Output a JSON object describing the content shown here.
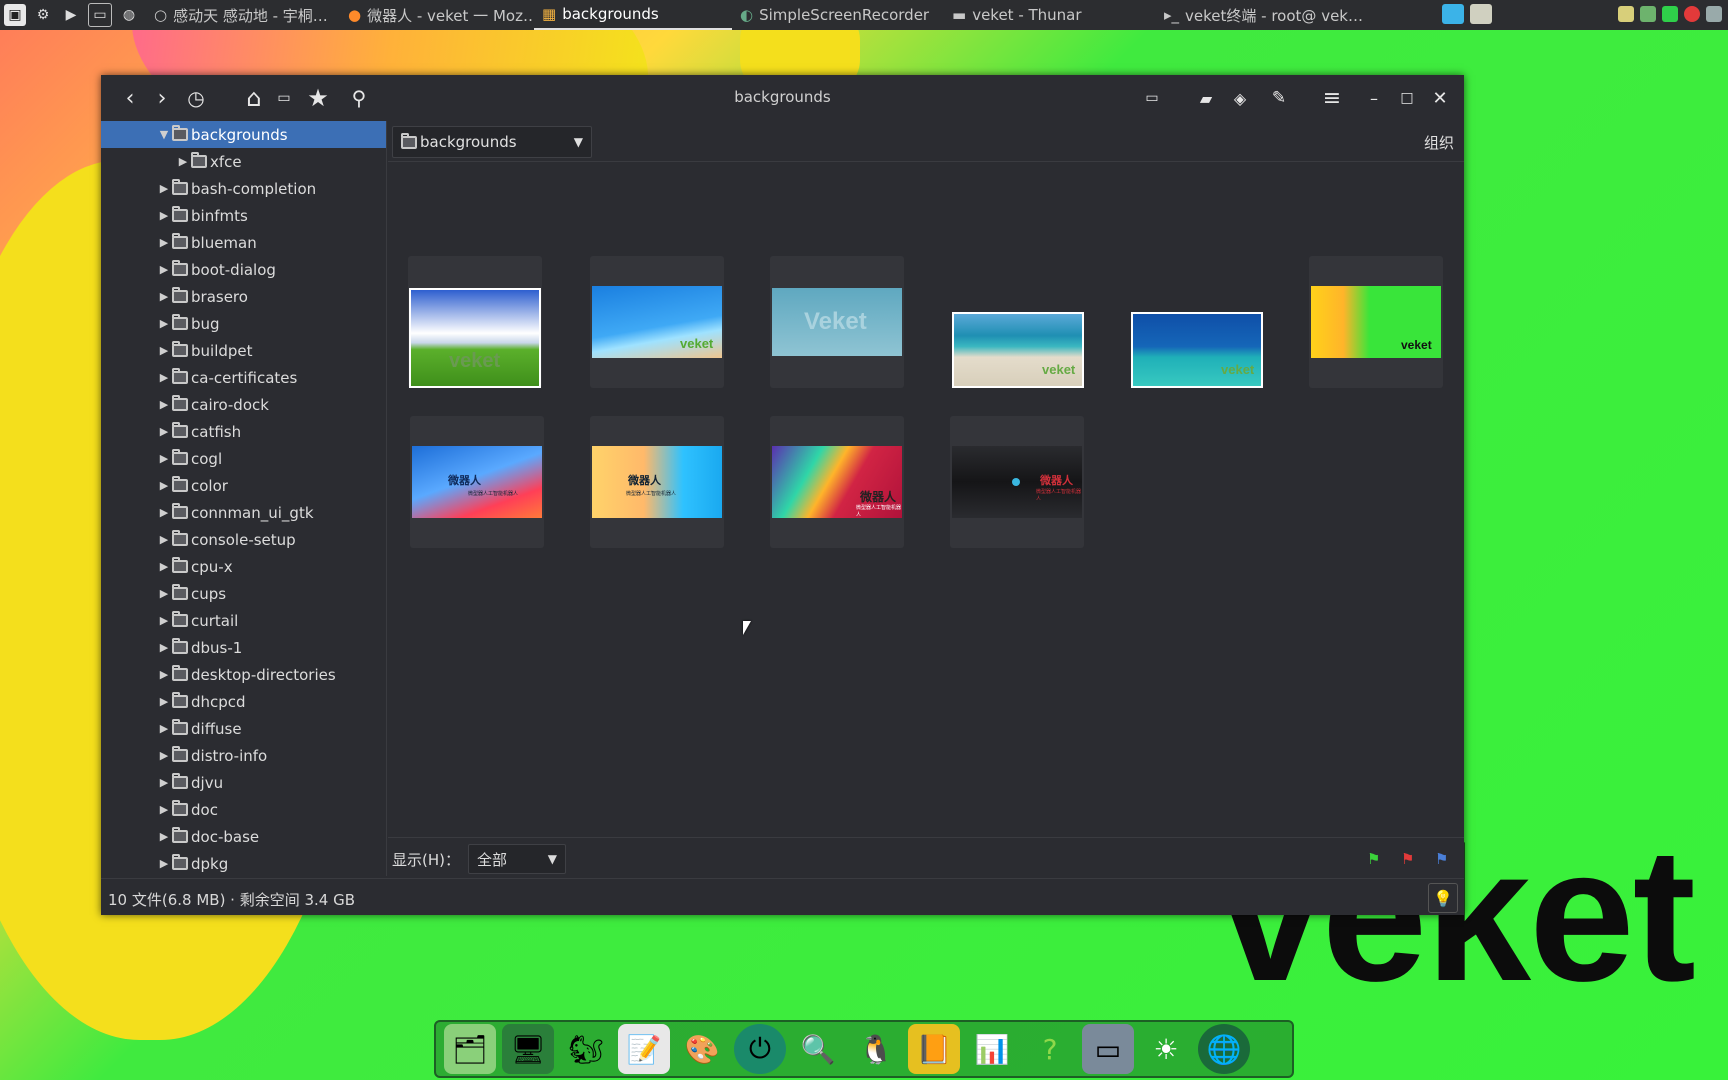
{
  "taskbar": {
    "tasks": [
      {
        "label": "感动天 感动地 - 宇桐…",
        "icon": "music-icon"
      },
      {
        "label": "微器人 - veket 一 Moz…",
        "icon": "firefox-icon"
      },
      {
        "label": "backgrounds",
        "icon": "image-viewer-icon",
        "active": true
      },
      {
        "label": "SimpleScreenRecorder",
        "icon": "recorder-icon"
      },
      {
        "label": "veket - Thunar",
        "icon": "folder-icon"
      },
      {
        "label": "veket终端 - root@ vek…",
        "icon": "terminal-icon"
      }
    ]
  },
  "window": {
    "title": "backgrounds",
    "toolbar": {
      "back": "‹",
      "forward": "›"
    }
  },
  "sidebar": {
    "selected": "backgrounds",
    "child": "xfce",
    "items": [
      "bash-completion",
      "binfmts",
      "blueman",
      "boot-dialog",
      "brasero",
      "bug",
      "buildpet",
      "ca-certificates",
      "cairo-dock",
      "catfish",
      "cogl",
      "color",
      "connman_ui_gtk",
      "console-setup",
      "cpu-x",
      "cups",
      "curtail",
      "dbus-1",
      "desktop-directories",
      "dhcpcd",
      "diffuse",
      "distro-info",
      "djvu",
      "doc",
      "doc-base",
      "dpkg"
    ]
  },
  "pathbar": {
    "current": "backgrounds",
    "organize": "组织"
  },
  "thumbnails": [
    {
      "label": "veket",
      "colors": [
        "#3a6fd0",
        "#ffffff",
        "#4caf2a"
      ]
    },
    {
      "label": "veket",
      "colors": [
        "#1a7fe0",
        "#8fd4ff",
        "#f0c58e"
      ]
    },
    {
      "label": "Veket",
      "colors": [
        "#6fb3c9",
        "#8fc4d3"
      ]
    },
    {
      "label": "veket",
      "colors": [
        "#1f8fb3",
        "#e4dccb"
      ]
    },
    {
      "label": "veket",
      "colors": [
        "#1566b8",
        "#1fb0b8"
      ]
    },
    {
      "label": "veket",
      "colors": [
        "#ffd21a",
        "#39e53a"
      ]
    },
    {
      "label": "微器人",
      "sub": "微型器人工智能机器人",
      "colors": [
        "#1d6ed8",
        "#ff3f57"
      ]
    },
    {
      "label": "微器人",
      "sub": "微型器人工智能机器人",
      "colors": [
        "#ffd36a",
        "#2fc2ff"
      ]
    },
    {
      "label": "微器人",
      "sub": "微型器人工智能机器人",
      "colors": [
        "#5a2fb0",
        "#d12444",
        "#2fd6a8"
      ]
    },
    {
      "label": "微器人",
      "sub": "微型器人工智能机器人",
      "colors": [
        "#1b1b1d",
        "#3a3b3f"
      ]
    }
  ],
  "filterbar": {
    "label": "显示(H)：",
    "value": "全部"
  },
  "status": {
    "text": "10 文件(6.8 MB) · 剩余空间 3.4 GB"
  },
  "desktop": {
    "wallpaper_text": "veket"
  }
}
